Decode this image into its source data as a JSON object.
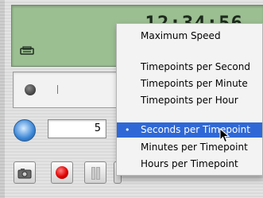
{
  "lcd": {
    "time": "12:34:56",
    "icon": "printer-icon"
  },
  "speed": {
    "value": "5",
    "icon": "speed-dial-icon"
  },
  "toolbar": {
    "camera_icon": "camera-icon",
    "record_icon": "record-icon",
    "pause_icon": "pause-icon"
  },
  "menu": {
    "items": [
      {
        "label": "Maximum Speed"
      },
      {
        "label": "Timepoints per Second"
      },
      {
        "label": "Timepoints per Minute"
      },
      {
        "label": "Timepoints per Hour"
      },
      {
        "label": "Seconds per Timepoint",
        "selected": true
      },
      {
        "label": "Minutes per Timepoint"
      },
      {
        "label": "Hours per Timepoint"
      }
    ],
    "selected_marker": "•"
  },
  "colors": {
    "lcd": "#9cbf92",
    "selection": "#2f68d6",
    "record": "#e00000"
  }
}
